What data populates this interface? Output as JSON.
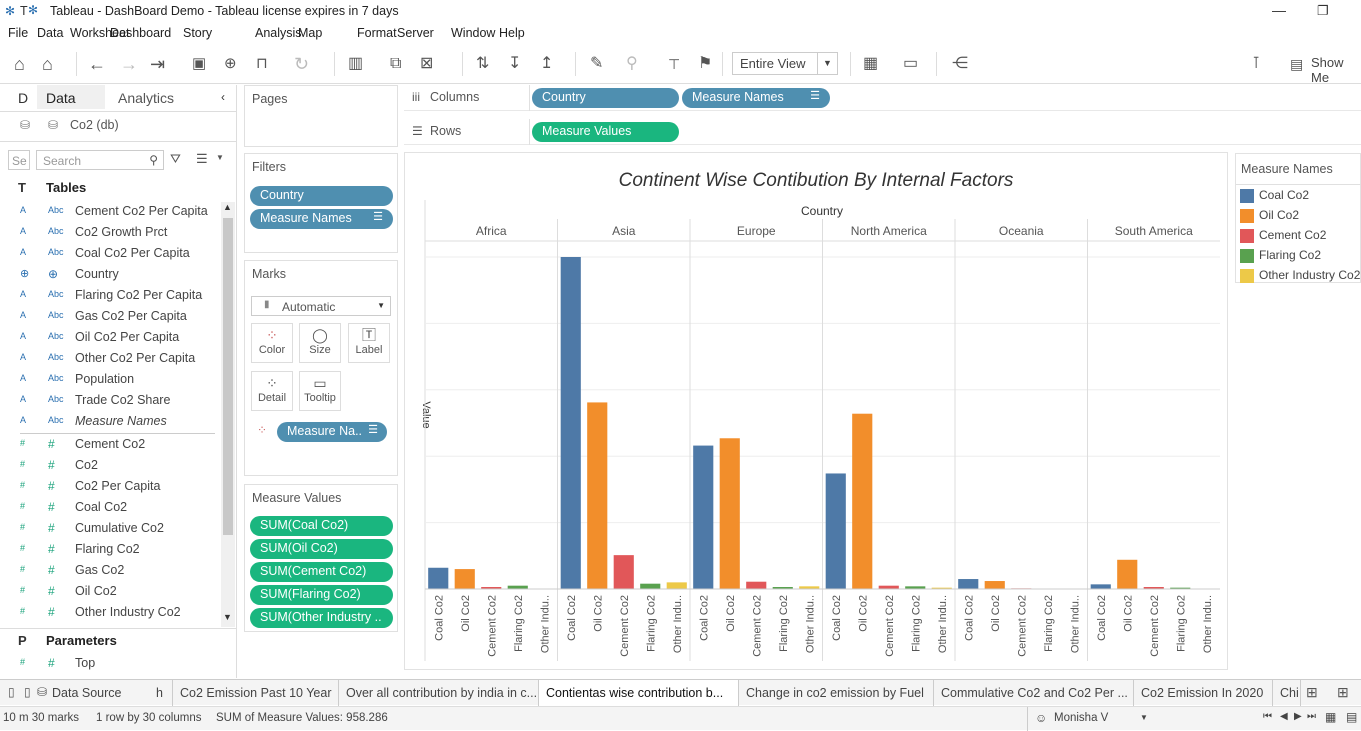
{
  "window": {
    "title": "Tableau - DashBoard Demo - Tableau license expires in 7 days",
    "icon_text": "T"
  },
  "menu": [
    "File",
    "Data",
    "Worksheet",
    "Dashboard",
    "Story",
    "Analysis",
    "Map",
    "Format",
    "Server",
    "Window",
    "Help"
  ],
  "toolbar": {
    "view_select": "Entire View",
    "show_me": "Show Me"
  },
  "data_pane": {
    "tab_data": "Data",
    "tab_analytics": "Analytics",
    "tab_d": "D",
    "datasource": "Co2 (db)",
    "search_placeholder": "Search",
    "search_prefix": "Se",
    "tables_header": "Tables",
    "tables_prefix": "T",
    "dimensions": [
      {
        "icon": "Abc",
        "name": "Cement Co2 Per Capita"
      },
      {
        "icon": "Abc",
        "name": "Co2 Growth Prct"
      },
      {
        "icon": "Abc",
        "name": "Coal Co2 Per Capita"
      },
      {
        "icon": "globe",
        "name": "Country"
      },
      {
        "icon": "Abc",
        "name": "Flaring Co2 Per Capita"
      },
      {
        "icon": "Abc",
        "name": "Gas Co2 Per Capita"
      },
      {
        "icon": "Abc",
        "name": "Oil Co2 Per Capita"
      },
      {
        "icon": "Abc",
        "name": "Other Co2 Per Capita"
      },
      {
        "icon": "Abc",
        "name": "Population"
      },
      {
        "icon": "Abc",
        "name": "Trade Co2 Share"
      },
      {
        "icon": "Abc",
        "name": "Measure Names"
      }
    ],
    "measures": [
      "Cement Co2",
      "Co2",
      "Co2 Per Capita",
      "Coal Co2",
      "Cumulative Co2",
      "Flaring Co2",
      "Gas Co2",
      "Oil Co2",
      "Other Industry Co2"
    ],
    "parameters_header": "Parameters",
    "parameters_prefix": "P",
    "parameters": [
      "Top"
    ]
  },
  "shelves": {
    "pages": "Pages",
    "filters": "Filters",
    "filter_pills": [
      "Country",
      "Measure Names"
    ],
    "marks": "Marks",
    "mark_type": "Automatic",
    "mark_buttons": [
      "Color",
      "Size",
      "Label",
      "Detail",
      "Tooltip"
    ],
    "marks_pill": "Measure Na..",
    "measure_values": "Measure Values",
    "measure_value_pills": [
      "SUM(Coal Co2)",
      "SUM(Oil Co2)",
      "SUM(Cement Co2)",
      "SUM(Flaring Co2)",
      "SUM(Other Industry .."
    ],
    "columns_label": "Columns",
    "columns_pills": [
      "Country",
      "Measure Names"
    ],
    "rows_label": "Rows",
    "rows_pills": [
      "Measure Values"
    ]
  },
  "chart_data": {
    "type": "bar",
    "title": "Continent Wise Contibution By Internal Factors",
    "column_header": "Country",
    "ylabel": "Value",
    "categories": [
      "Africa",
      "Asia",
      "Europe",
      "North America",
      "Oceania",
      "South America"
    ],
    "series": [
      {
        "name": "Coal Co2",
        "color": "#4e79a7",
        "values": [
          32,
          500,
          216,
          174,
          15,
          7
        ]
      },
      {
        "name": "Oil Co2",
        "color": "#f28e2b",
        "values": [
          30,
          281,
          227,
          264,
          12,
          44
        ]
      },
      {
        "name": "Cement Co2",
        "color": "#e15759",
        "values": [
          3,
          51,
          11,
          5,
          1,
          3
        ]
      },
      {
        "name": "Flaring Co2",
        "color": "#59a14f",
        "values": [
          5,
          8,
          3,
          4,
          0.5,
          2
        ]
      },
      {
        "name": "Other Industry Co2",
        "color": "#edc948",
        "values": [
          0.3,
          10,
          4,
          2,
          0.2,
          0.3
        ]
      }
    ],
    "xtick_labels": [
      "Coal Co2",
      "Oil Co2",
      "Cement Co2",
      "Flaring Co2",
      "Other Indu.."
    ],
    "ylim": [
      0,
      500
    ],
    "grid": true
  },
  "legend": {
    "title": "Measure Names",
    "items": [
      {
        "label": "Coal Co2",
        "color": "#4e79a7"
      },
      {
        "label": "Oil Co2",
        "color": "#f28e2b"
      },
      {
        "label": "Cement Co2",
        "color": "#e15759"
      },
      {
        "label": "Flaring Co2",
        "color": "#59a14f"
      },
      {
        "label": "Other Industry Co2",
        "color": "#edc948"
      }
    ]
  },
  "sheet_tabs": {
    "data_source": "Data Source",
    "tabs": [
      "Co2 Emission Past 10 Year",
      "Over all contribution by india in c...",
      "Contientas wise contribution b...",
      "Change in co2 emission by Fuel",
      "Commulative Co2 and Co2 Per ...",
      "Co2 Emission In 2020",
      "Chi"
    ],
    "active_index": 2,
    "partial_left": "h"
  },
  "status": {
    "marks": "10 m 30 marks",
    "rows_cols": "1 row by 30 columns",
    "sum": "SUM of Measure Values: 958.286",
    "user": "Monisha V"
  }
}
